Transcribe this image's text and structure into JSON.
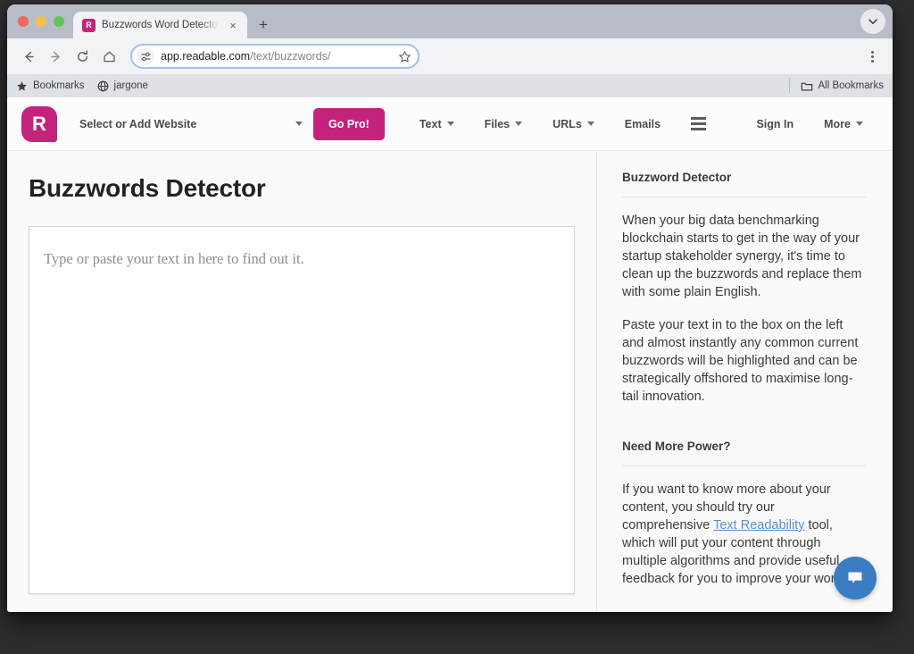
{
  "browser": {
    "tab": {
      "title": "Buzzwords Word Detector - T",
      "favicon_letter": "R",
      "favicon_name": "readable-favicon",
      "close_label": "×"
    },
    "new_tab_label": "+",
    "tabstrip_menu_icon": "chevron-down-icon",
    "toolbar": {
      "back_icon": "back-arrow-icon",
      "forward_icon": "forward-arrow-icon",
      "reload_icon": "reload-icon",
      "home_icon": "home-icon",
      "site_info_icon": "site-settings-icon",
      "url_domain": "app.readable.com",
      "url_path": "/text/buzzwords/",
      "bookmark_icon": "star-icon",
      "menu_icon": "three-dot-menu-icon"
    },
    "bookmarks_bar": {
      "items": [
        {
          "label": "Bookmarks",
          "icon": "star-icon"
        },
        {
          "label": "jargone",
          "icon": "globe-icon"
        }
      ],
      "all_bookmarks_label": "All Bookmarks",
      "all_bookmarks_icon": "folder-icon"
    }
  },
  "app": {
    "logo_letter": "R",
    "site_selector": {
      "label": "Select or Add Website",
      "caret_icon": "chevron-down-icon"
    },
    "go_pro_label": "Go Pro!",
    "nav_links": [
      {
        "label": "Text",
        "has_caret": true
      },
      {
        "label": "Files",
        "has_caret": true
      },
      {
        "label": "URLs",
        "has_caret": true
      },
      {
        "label": "Emails",
        "has_caret": false
      }
    ],
    "hamburger_icon": "hamburger-menu-icon",
    "sign_in_label": "Sign In",
    "more_label": "More"
  },
  "main": {
    "page_title": "Buzzwords Detector",
    "textarea_placeholder": "Type or paste your text in here to find out it.",
    "textarea_value": ""
  },
  "sidebar": {
    "section_1": {
      "heading": "Buzzword Detector",
      "paragraph_1": "When your big data benchmarking blockchain starts to get in the way of your startup stakeholder synergy, it's time to clean up the buzzwords and replace them with some plain English.",
      "paragraph_2": "Paste your text in to the box on the left and almost instantly any common current buzzwords will be highlighted and can be strategically offshored to maximise long-tail innovation."
    },
    "section_2": {
      "heading": "Need More Power?",
      "paragraph_before_link": "If you want to know more about your content, you should try our comprehensive ",
      "link_text": "Text Readability",
      "paragraph_after_link": " tool, which will put your content through multiple algorithms and provide useful feedback for you to improve your work."
    }
  },
  "chat_widget": {
    "icon": "chat-bubble-icon",
    "color": "#3a7dc2"
  }
}
